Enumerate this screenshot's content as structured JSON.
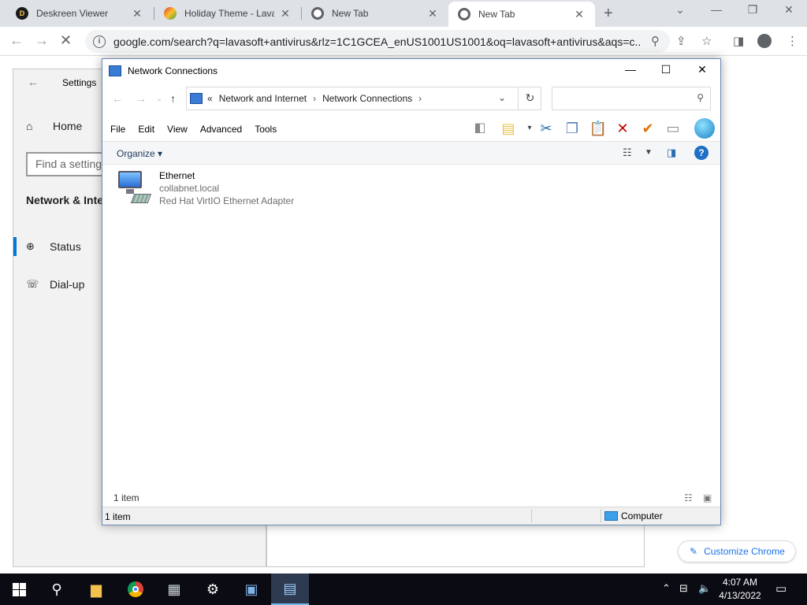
{
  "browser": {
    "tabs": [
      {
        "title": "Deskreen Viewer",
        "icon": "deskreen-icon"
      },
      {
        "title": "Holiday Theme - Lavas",
        "icon": "lavasoft-icon"
      },
      {
        "title": "New Tab",
        "icon": "chrome-icon"
      },
      {
        "title": "New Tab",
        "icon": "chrome-icon"
      }
    ],
    "url": "google.com/search?q=lavasoft+antivirus&rlz=1C1GCEA_enUS1001US1001&oq=lavasoft+antivirus&aqs=c...",
    "customize_label": "Customize Chrome"
  },
  "settings": {
    "title": "Settings",
    "home_label": "Home",
    "search_placeholder": "Find a setting",
    "section_title": "Network & Inte",
    "nav": [
      {
        "label": "Status",
        "icon": "globe-icon"
      },
      {
        "label": "Dial-up",
        "icon": "dialup-icon"
      }
    ]
  },
  "explorer": {
    "title": "Network Connections",
    "breadcrumb_prefix": "«",
    "breadcrumb": [
      "Network and Internet",
      "Network Connections"
    ],
    "menu": [
      "File",
      "Edit",
      "View",
      "Advanced",
      "Tools"
    ],
    "organize_label": "Organize",
    "item": {
      "name": "Ethernet",
      "network": "collabnet.local",
      "adapter": "Red Hat VirtIO Ethernet Adapter"
    },
    "inner_status": "1 item",
    "status_left": "1 item",
    "status_location": "Computer"
  },
  "taskbar": {
    "time": "4:07 AM",
    "date": "4/13/2022"
  },
  "colors": {
    "accent": "#0078d7",
    "delete_red": "#c00000",
    "check_orange": "#e07000",
    "chrome_link": "#1a73e8"
  }
}
